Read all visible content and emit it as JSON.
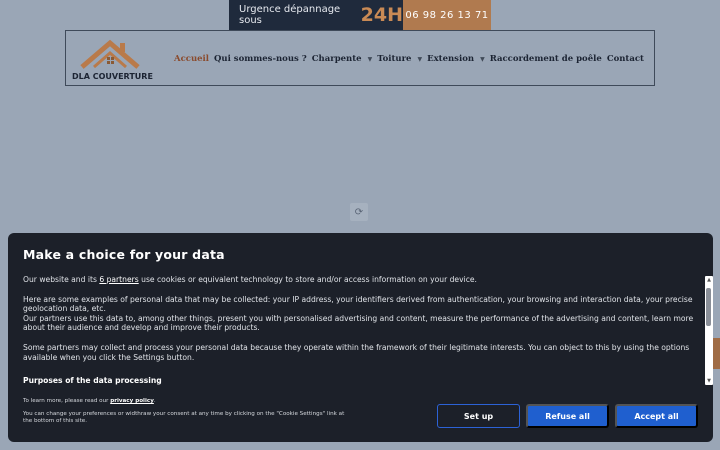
{
  "banner": {
    "urgence_text": "Urgence dépannage sous",
    "urgence_hours": "24H",
    "phone": "06 98 26 13 71"
  },
  "header": {
    "logo_text": "DLA COUVERTURE",
    "nav": [
      {
        "label": "Accueil"
      },
      {
        "label": "Qui sommes-nous ?"
      },
      {
        "label": "Charpente"
      },
      {
        "label": "Toiture"
      },
      {
        "label": "Extension"
      },
      {
        "label": "Raccordement de poêle"
      },
      {
        "label": "Contact"
      }
    ]
  },
  "colors": {
    "accent": "#c98a55",
    "consent_bg": "#1c2029",
    "button_blue": "#1f5fcf"
  },
  "consent": {
    "title": "Make a choice for your data",
    "p1_pre": "Our website and its",
    "p1_link": "6 partners",
    "p1_post": "use cookies or equivalent technology to store and/or access information on your device.",
    "p2": "Here are some examples of personal data that may be collected: your IP address, your identifiers derived from authentication, your browsing and interaction data, your precise geolocation data, etc.",
    "p3": "Our partners use this data to, among other things, present you with personalised advertising and content, measure the performance of the advertising and content, learn more about their audience and develop and improve their products.",
    "p4": "Some partners may collect and process your personal data because they operate within the framework of their legitimate interests. You can object to this by using the options available when you click the Settings button.",
    "purposes_heading": "Purposes of the data processing",
    "footer_pre": "To learn more, please read our",
    "footer_link": "privacy policy",
    "footer_post": ".",
    "footer_line2": "You can change your preferences or widthraw your consent at any time by clicking on the \"Cookie Settings\" link at the bottom of this site.",
    "buttons": {
      "setup": "Set up",
      "refuse": "Refuse all",
      "accept": "Accept all"
    }
  }
}
